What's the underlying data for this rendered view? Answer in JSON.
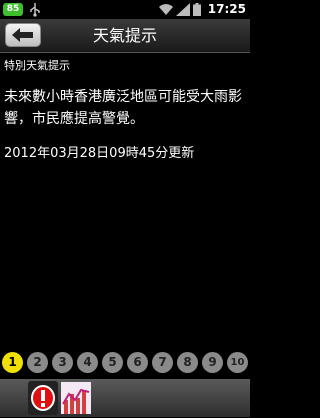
{
  "status_bar": {
    "battery_level": "85",
    "time": "17:25"
  },
  "title_bar": {
    "title": "天氣提示"
  },
  "content": {
    "subtitle": "特別天氣提示",
    "message": "未來數小時香港廣泛地區可能受大雨影響，市民應提高警覺。",
    "updated": "2012年03月28日09時45分更新"
  },
  "pager": {
    "pages": [
      "1",
      "2",
      "3",
      "4",
      "5",
      "6",
      "7",
      "8",
      "9",
      "10"
    ],
    "active_page": "1"
  },
  "bottom_bar": {
    "icons": [
      "warning-icon",
      "rainstorm-chart-icon"
    ]
  }
}
